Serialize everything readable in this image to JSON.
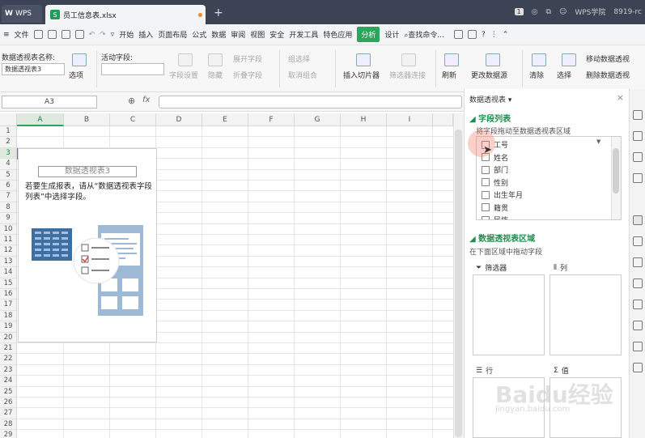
{
  "titlebar": {
    "app_tab": "WPS",
    "file_tab": "员工信息表.xlsx",
    "right_badge": "1",
    "account": "WPS学院",
    "right_text": "8919-rc"
  },
  "menubar": {
    "file_menu": "文件",
    "items": [
      "开始",
      "插入",
      "页面布局",
      "公式",
      "数据",
      "审阅",
      "视图",
      "安全",
      "开发工具",
      "特色应用"
    ],
    "active_item": "分析",
    "design_item": "设计",
    "search": "查找命令..."
  },
  "ribbon": {
    "pivot_name_label": "数据透视表名称:",
    "pivot_name_value": "数据透视表3",
    "options_btn": "选项",
    "active_field_label": "活动字段:",
    "field_settings": "字段设置",
    "hide": "隐藏",
    "expand_field": "展开字段",
    "collapse_field": "折叠字段",
    "group_select": "组选择",
    "ungroup": "取消组合",
    "insert_slicer": "插入切片器",
    "filter_connect": "筛选器连接",
    "refresh": "刷新",
    "change_source": "更改数据源",
    "clear": "清除",
    "select": "选择",
    "move_pivot": "移动数据透视",
    "delete_pivot": "删除数据透视"
  },
  "formula_bar": {
    "cell_ref": "A3",
    "fx": "fx"
  },
  "grid": {
    "columns": [
      "A",
      "B",
      "C",
      "D",
      "E",
      "F",
      "G",
      "H",
      "I"
    ],
    "rows": [
      "1",
      "2",
      "3",
      "4",
      "5",
      "6",
      "7",
      "8",
      "9",
      "10",
      "11",
      "12",
      "13",
      "14",
      "15",
      "16",
      "17",
      "18",
      "19",
      "20",
      "21",
      "22",
      "23",
      "24",
      "25",
      "26",
      "27",
      "28",
      "29"
    ],
    "selected_col": "A",
    "selected_row": "3"
  },
  "pivot_placeholder": {
    "title": "数据透视表3",
    "message": "若要生成报表，请从“数据透视表字段列表”中选择字段。"
  },
  "pane": {
    "title": "数据透视表",
    "field_list_title": "字段列表",
    "field_list_hint": "将字段拖动至数据透视表区域",
    "fields": [
      "工号",
      "姓名",
      "部门",
      "性别",
      "出生年月",
      "籍贯",
      "民族"
    ],
    "areas_title": "数据透视表区域",
    "areas_hint": "在下面区域中拖动字段",
    "filter_zone": "筛选器",
    "col_zone": "列",
    "row_zone": "行",
    "value_zone": "值"
  },
  "watermark": {
    "brand": "Baidu经验",
    "url": "jingyan.baidu.com"
  },
  "colors": {
    "accent": "#2ea55d",
    "titlebar": "#3c4355"
  }
}
